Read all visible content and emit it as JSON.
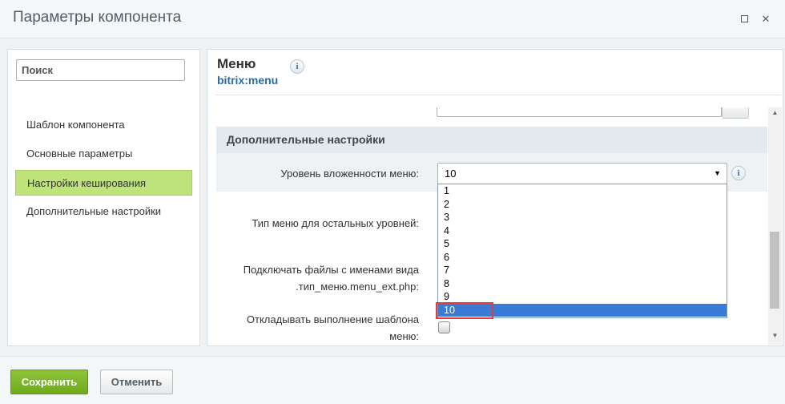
{
  "window": {
    "title": "Параметры компонента"
  },
  "sidebar": {
    "search_placeholder": "Поиск",
    "items": [
      {
        "label": "Шаблон компонента"
      },
      {
        "label": "Основные параметры"
      },
      {
        "label": "Настройки кеширования",
        "active": true
      },
      {
        "label": "Дополнительные настройки"
      }
    ]
  },
  "component": {
    "name": "Меню",
    "id": "bitrix:menu"
  },
  "section": {
    "title": "Дополнительные настройки"
  },
  "fields": {
    "menu_depth_label": "Уровень вложенности меню:",
    "menu_depth_value": "10",
    "menu_depth_options": [
      "1",
      "2",
      "3",
      "4",
      "5",
      "6",
      "7",
      "8",
      "9",
      "10"
    ],
    "child_menu_type_label": "Тип меню для остальных уровней:",
    "use_ext_label_line1": "Подключать файлы с именами вида",
    "use_ext_label_line2": ".тип_меню.menu_ext.php:",
    "delay_label_line1": "Откладывать выполнение шаблона",
    "delay_label_line2": "меню:"
  },
  "icons": {
    "info": "i",
    "dropdown_arrow": "▼",
    "close": "✕",
    "scroll_up": "▲",
    "scroll_down": "▼"
  },
  "footer": {
    "save_label": "Сохранить",
    "cancel_label": "Отменить"
  },
  "colors": {
    "active_item": "#bde37a",
    "save_button": "#7ab52a",
    "selected_option": "#3a7bd5",
    "highlight_border": "#e23b3b",
    "component_id": "#2c6ba0"
  }
}
